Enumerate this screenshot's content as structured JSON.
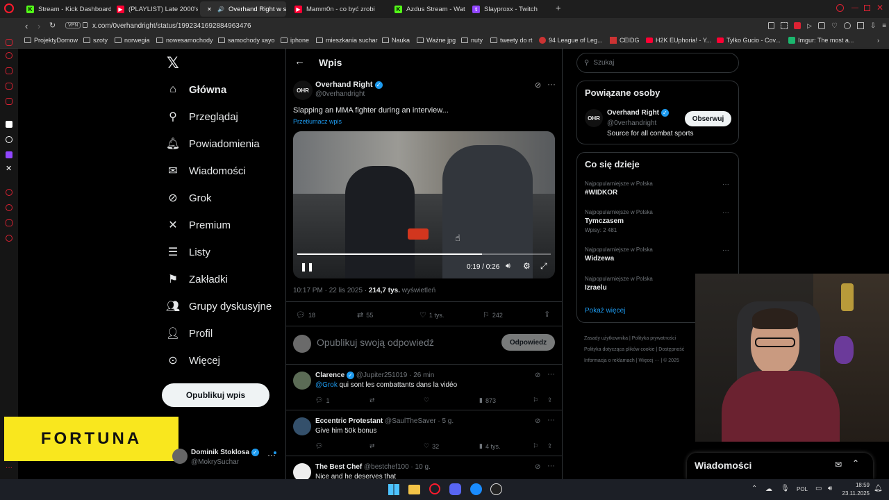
{
  "browser": {
    "tabs": [
      {
        "label": "Stream - Kick Dashboard",
        "icon": "kick-icon",
        "color": "#53fc18",
        "active": false
      },
      {
        "label": "(PLAYLIST) Late 2000's E",
        "icon": "youtube-icon",
        "color": "#ff0033",
        "active": false
      },
      {
        "label": "Overhand Right w se",
        "icon": "x-icon",
        "color": "#ffffff",
        "active": true
      },
      {
        "label": "Mamm0n - co być zrobić",
        "icon": "youtube-icon",
        "color": "#ff0033",
        "active": false
      },
      {
        "label": "Azdus Stream - Watch Li",
        "icon": "kick-icon",
        "color": "#53fc18",
        "active": false
      },
      {
        "label": "Slayproxx - Twitch",
        "icon": "twitch-icon",
        "color": "#9146ff",
        "active": false
      }
    ],
    "vpn": "VPN",
    "url": "x.com/0verhandright/status/1992341692884963476",
    "bookmarks": [
      "ProjektyDomow",
      "szoty",
      "norwegia",
      "nowesamochody",
      "samochody xayo",
      "iphone",
      "mieszkania suchar",
      "Nauka",
      "Ważne jpg",
      "nuty",
      "tweety do rt",
      "94 League of Leg...",
      "CEIDG",
      "H2K EUphoria! - Y...",
      "Tylko Gucio - Cov...",
      "Imgur: The most a..."
    ]
  },
  "nav": {
    "items": [
      "Główna",
      "Przeglądaj",
      "Powiadomienia",
      "Wiadomości",
      "Grok",
      "Premium",
      "Listy",
      "Zakładki",
      "Grupy dyskusyjne",
      "Profil",
      "Więcej"
    ],
    "post_button": "Opublikuj wpis",
    "user_name": "Dominik Stoklosa",
    "user_handle": "@MokrySuchar"
  },
  "ad": {
    "text": "FORTUNA"
  },
  "post": {
    "header_title": "Wpis",
    "author_name": "Overhand Right",
    "author_handle": "@0verhandright",
    "avatar_text": "OHR",
    "text": "Slapping an MMA fighter during an interview...",
    "translate": "Przetłumacz wpis",
    "video_time": "0:19 / 0:26",
    "video_progress": 0.73,
    "meta_time": "10:17 PM · 22 lis 2025 · ",
    "views_count": "214,7 tys.",
    "views_label": " wyświetleń",
    "replies": "18",
    "reposts": "55",
    "likes": "1 tys.",
    "bookmarks": "242",
    "reply_placeholder": "Opublikuj swoją odpowiedź",
    "reply_button": "Odpowiedz"
  },
  "replies": [
    {
      "name": "Clarence",
      "handle": "@Jupiter251019 · 26 min",
      "mention": "@Grok",
      "text": " qui sont les combattants dans la vidéo",
      "replies": "1",
      "reposts": "",
      "likes": "",
      "views": "873"
    },
    {
      "name": "Eccentric Protestant",
      "handle": "@SaulTheSaver · 5 g.",
      "mention": "",
      "text": "Give him 50k bonus",
      "replies": "",
      "reposts": "",
      "likes": "32",
      "views": "4 tys."
    },
    {
      "name": "The Best Chef",
      "handle": "@bestchef100 · 10 g.",
      "mention": "",
      "text": "Nice and he deserves that",
      "replies": "",
      "reposts": "",
      "likes": "",
      "views": ""
    }
  ],
  "search": {
    "placeholder": "Szukaj"
  },
  "related": {
    "title": "Powiązane osoby",
    "name": "Overhand Right",
    "handle": "@0verhandright",
    "bio": "Source for all combat sports",
    "follow": "Obserwuj"
  },
  "trends": {
    "title": "Co się dzieje",
    "items": [
      {
        "context": "Najpopularniejsze w Polska",
        "name": "#WIDKOR",
        "count": ""
      },
      {
        "context": "Najpopularniejsze w Polska",
        "name": "Tymczasem",
        "count": "Wpisy: 2 481"
      },
      {
        "context": "Najpopularniejsze w Polska",
        "name": "Widzewa",
        "count": ""
      },
      {
        "context": "Najpopularniejsze w Polska",
        "name": "Izraelu",
        "count": ""
      }
    ],
    "more": "Pokaż więcej"
  },
  "footer": {
    "links": [
      "Zasady użytkownika",
      "Polityka prywatności",
      "Polityka dotycząca plików cookie",
      "Dostępność",
      "Informacja o reklamach",
      "Więcej ···",
      "© 2025"
    ]
  },
  "messages": {
    "title": "Wiadomości"
  },
  "taskbar": {
    "lang": "POL",
    "time": "18:59",
    "date": "23.11.2025"
  }
}
